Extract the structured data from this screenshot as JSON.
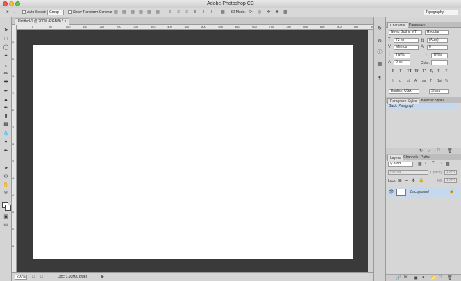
{
  "window": {
    "title": "Adobe Photoshop CC"
  },
  "options_bar": {
    "auto_select_label": "Auto-Select:",
    "auto_select_value": "Group",
    "transform_label": "Show Transform Controls",
    "mode_label": "3D Mode:",
    "workspace": "Typography"
  },
  "document": {
    "tab_title": "Untitled-1 @ 200% (RGB/8) *"
  },
  "ruler": {
    "h_labels": [
      "0",
      "50",
      "100",
      "150",
      "200",
      "250",
      "300",
      "350",
      "400",
      "450",
      "500",
      "550",
      "600",
      "650",
      "700",
      "750",
      "800",
      "850",
      "900",
      "950",
      "1000"
    ],
    "v_labels": [
      "0",
      "5",
      "1",
      "1",
      "2",
      "2",
      "3",
      "3",
      "4",
      "4",
      "5",
      "5",
      "6"
    ]
  },
  "status": {
    "zoom": "200%",
    "doc_info": "Doc: 1.93M/0 bytes"
  },
  "character": {
    "tabs": [
      "Character",
      "Paragraph"
    ],
    "font_family": "News Gothic MT",
    "font_style": "Regular",
    "font_size": "72 px",
    "leading": "(Auto)",
    "kerning": "Metrics",
    "tracking": "0",
    "vscale": "100%",
    "hscale": "100%",
    "baseline": "0 px",
    "color_label": "Color:",
    "language": "English: USA",
    "antialias": "Sharp",
    "type_styles": [
      "T",
      "T",
      "TT",
      "Tr",
      "T'",
      "T,",
      "T",
      "T"
    ],
    "opentype": [
      "fi",
      "σ",
      "st",
      "A",
      "aa",
      "T",
      "1st",
      "½"
    ]
  },
  "paragraph_styles": {
    "tabs": [
      "Paragraph Styles",
      "Character Styles"
    ],
    "items": [
      "Basic Paragraph"
    ]
  },
  "layers": {
    "tabs": [
      "Layers",
      "Channels",
      "Paths"
    ],
    "filter": "Kind",
    "blend_mode": "Normal",
    "opacity_label": "Opacity:",
    "opacity": "100%",
    "lock_label": "Lock:",
    "fill_label": "Fill:",
    "fill": "100%",
    "items": [
      {
        "name": "Background",
        "locked": true,
        "visible": true
      }
    ]
  },
  "colors": {
    "accent": "#c6d8ee",
    "canvas_bg": "#3a3a3a",
    "panel": "#d6d6d6"
  }
}
